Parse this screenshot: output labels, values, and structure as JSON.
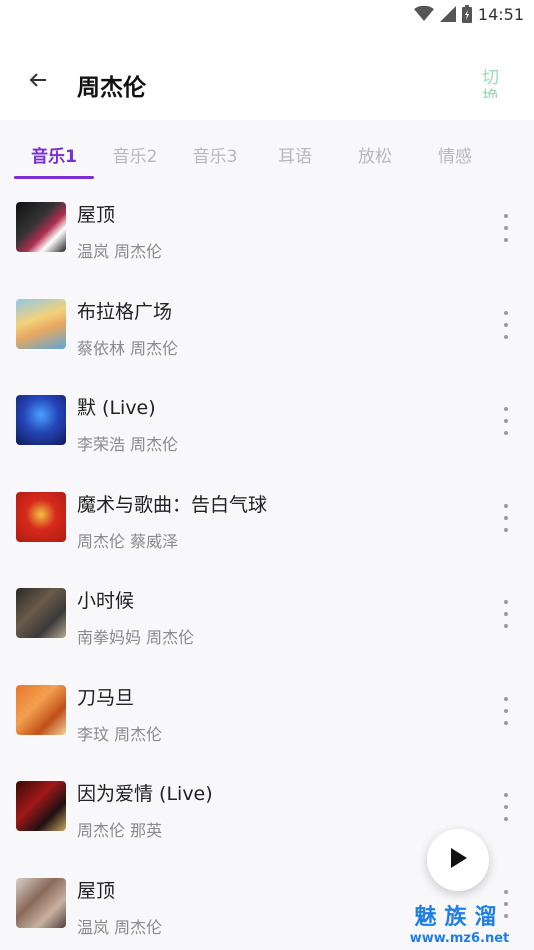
{
  "status_bar": {
    "time": "14:51",
    "icons": [
      "wifi-icon",
      "signal-icon",
      "battery-icon"
    ]
  },
  "header": {
    "title": "周杰伦",
    "back_icon": "arrow-left-icon",
    "switch_label": "切换"
  },
  "tabs": [
    {
      "label": "音乐1",
      "active": true
    },
    {
      "label": "音乐2",
      "active": false
    },
    {
      "label": "音乐3",
      "active": false
    },
    {
      "label": "耳语",
      "active": false
    },
    {
      "label": "放松",
      "active": false
    },
    {
      "label": "情感",
      "active": false
    }
  ],
  "songs": [
    {
      "title": "屋顶",
      "artist": "温岚 周杰伦"
    },
    {
      "title": "布拉格广场",
      "artist": "蔡依林 周杰伦"
    },
    {
      "title": "默 (Live)",
      "artist": "李荣浩 周杰伦"
    },
    {
      "title": "魔术与歌曲：告白气球",
      "artist": "周杰伦 蔡威泽"
    },
    {
      "title": "小时候",
      "artist": "南拳妈妈 周杰伦"
    },
    {
      "title": "刀马旦",
      "artist": "李玟 周杰伦"
    },
    {
      "title": "因为爱情 (Live)",
      "artist": "周杰伦 那英"
    },
    {
      "title": "屋顶",
      "artist": "温岚 周杰伦"
    }
  ],
  "fab": {
    "icon": "play-icon"
  },
  "watermark": {
    "main": "魅族溜",
    "url": "www.mz6.net"
  },
  "colors": {
    "accent": "#7a2fd6",
    "switch": "#9ad8b8",
    "watermark": "#1f7fe6"
  }
}
